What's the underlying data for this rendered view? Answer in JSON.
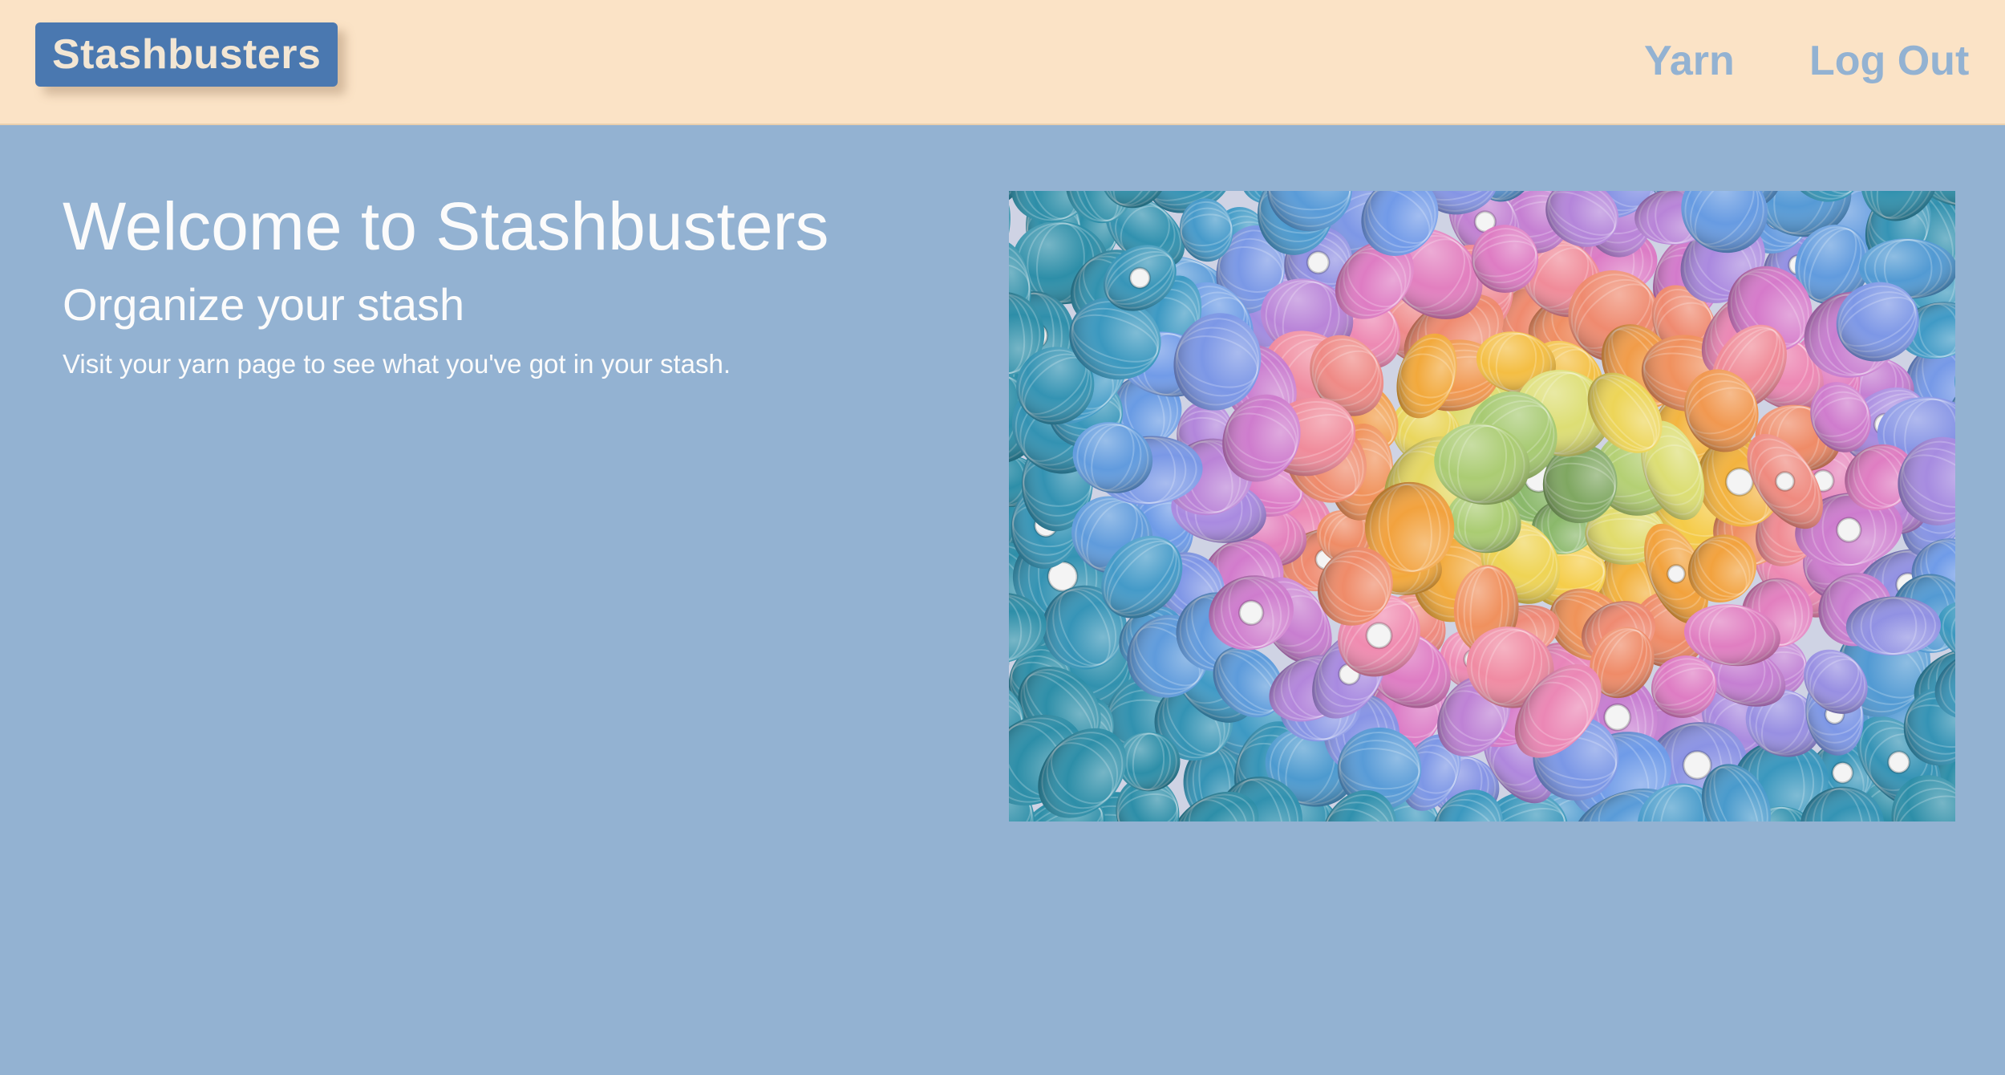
{
  "header": {
    "brand": "Stashbusters",
    "nav": {
      "yarn": "Yarn",
      "log_out": "Log Out"
    }
  },
  "main": {
    "title": "Welcome to Stashbusters",
    "subtitle": "Organize your stash",
    "intro": "Visit your yarn page to see what you've got in your stash."
  },
  "colors": {
    "page_background": "#93b2d2",
    "header_background": "#fbe3c6",
    "brand_background": "#4a78b0",
    "brand_text": "#f3e6d3",
    "nav_text": "#93b2d2",
    "body_text": "#fbfbfb"
  }
}
